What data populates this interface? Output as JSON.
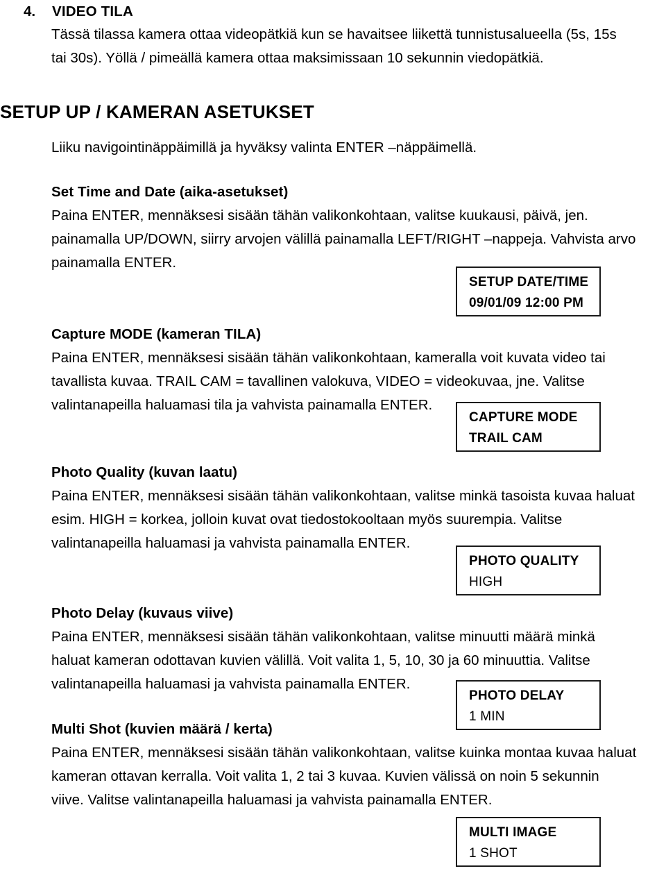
{
  "document": {
    "language": "fi",
    "sections": {
      "video_mode": {
        "number": "4.",
        "title": "VIDEO TILA",
        "lines": [
          "Tässä tilassa kamera ottaa videopätkiä kun se havaitsee liikettä tunnistusalueella (5s, 15s",
          "tai 30s). Yöllä / pimeällä kamera ottaa maksimissaan 10 sekunnin viedopätkiä."
        ]
      },
      "setup": {
        "heading": "SETUP UP / KAMERAN ASETUKSET",
        "subtitle": "Liiku navigointinäppäimillä ja hyväksy valinta ENTER –näppäimellä."
      },
      "set_time_and_date": {
        "heading": "Set Time and Date (aika-asetukset)",
        "lines": [
          "Paina ENTER, mennäksesi sisään tähän valikonkohtaan, valitse kuukausi, päivä, jen.",
          "painamalla UP/DOWN, siirry arvojen välillä painamalla LEFT/RIGHT –nappeja. Vahvista arvo",
          "painamalla ENTER."
        ]
      },
      "capture_mode": {
        "heading": "Capture MODE (kameran TILA)",
        "lines": [
          "Paina ENTER, mennäksesi sisään tähän valikonkohtaan, kameralla voit kuvata video tai",
          "tavallista kuvaa. TRAIL CAM = tavallinen valokuva, VIDEO = videokuvaa, jne. Valitse",
          "valintanapeilla haluamasi tila ja vahvista painamalla ENTER."
        ]
      },
      "photo_quality": {
        "heading": "Photo Quality (kuvan laatu)",
        "lines": [
          "Paina ENTER, mennäksesi sisään tähän valikonkohtaan, valitse minkä tasoista kuvaa haluat",
          "esim. HIGH = korkea, jolloin kuvat ovat tiedostokooltaan myös suurempia. Valitse",
          "valintanapeilla haluamasi ja vahvista painamalla ENTER."
        ]
      },
      "photo_delay": {
        "heading": "Photo Delay (kuvaus viive)",
        "lines": [
          "Paina ENTER, mennäksesi sisään tähän valikonkohtaan, valitse minuutti määrä minkä",
          "haluat kameran odottavan kuvien välillä. Voit valita 1, 5, 10, 30 ja 60 minuuttia. Valitse",
          "valintanapeilla haluamasi ja vahvista painamalla ENTER."
        ]
      },
      "multi_shot": {
        "heading": "Multi Shot (kuvien määrä / kerta)",
        "lines": [
          "Paina ENTER, mennäksesi sisään tähän valikonkohtaan, valitse kuinka montaa kuvaa haluat",
          "kameran ottavan kerralla. Voit valita 1, 2 tai 3 kuvaa. Kuvien välissä on noin 5 sekunnin",
          "viive. Valitse valintanapeilla haluamasi ja vahvista painamalla ENTER."
        ]
      }
    },
    "lcd_screens": [
      {
        "title": "SETUP DATE/TIME",
        "value": "09/01/09 12:00 PM",
        "value_bold": true
      },
      {
        "title": "CAPTURE MODE",
        "value": "TRAIL CAM",
        "value_bold": true
      },
      {
        "title": "PHOTO QUALITY",
        "value": "HIGH",
        "value_bold": false
      },
      {
        "title": "PHOTO DELAY",
        "value": "1 MIN",
        "value_bold": false
      },
      {
        "title": "MULTI IMAGE",
        "value": "1 SHOT",
        "value_bold": false
      }
    ],
    "colors": {
      "text": "#000000",
      "box_border": "#1a1a1a",
      "background": "#ffffff"
    }
  }
}
